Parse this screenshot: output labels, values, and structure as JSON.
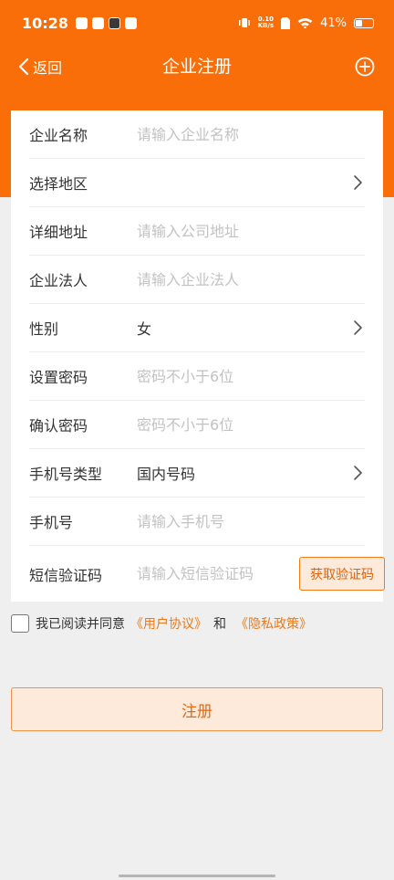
{
  "status_bar": {
    "time": "10:28",
    "net_speed_value": "0.10",
    "net_speed_unit": "KB/s",
    "battery": "41%",
    "battery_level": 0.41
  },
  "header": {
    "back_label": "返回",
    "title": "企业注册",
    "add_icon": "plus-circle-icon"
  },
  "form": {
    "rows": [
      {
        "label": "企业名称",
        "placeholder": "请输入企业名称"
      },
      {
        "label": "选择地区",
        "value": ""
      },
      {
        "label": "详细地址",
        "placeholder": "请输入公司地址"
      },
      {
        "label": "企业法人",
        "placeholder": "请输入企业法人"
      },
      {
        "label": "性别",
        "value": "女"
      },
      {
        "label": "设置密码",
        "placeholder": "密码不小于6位"
      },
      {
        "label": "确认密码",
        "placeholder": "密码不小于6位"
      },
      {
        "label": "手机号类型",
        "value": "国内号码"
      },
      {
        "label": "手机号",
        "placeholder": "请输入手机号"
      },
      {
        "label": "短信验证码",
        "placeholder": "请输入短信验证码"
      }
    ],
    "get_code_label": "获取验证码"
  },
  "agreement": {
    "prefix": "我已阅读并同意",
    "user_agreement": "《用户协议》",
    "and": "和",
    "privacy_policy": "《隐私政策》"
  },
  "register_label": "注册",
  "colors": {
    "brand_orange": "#fa6e0a",
    "link_orange": "#ea7a1d",
    "button_fill": "#fdeadb"
  }
}
